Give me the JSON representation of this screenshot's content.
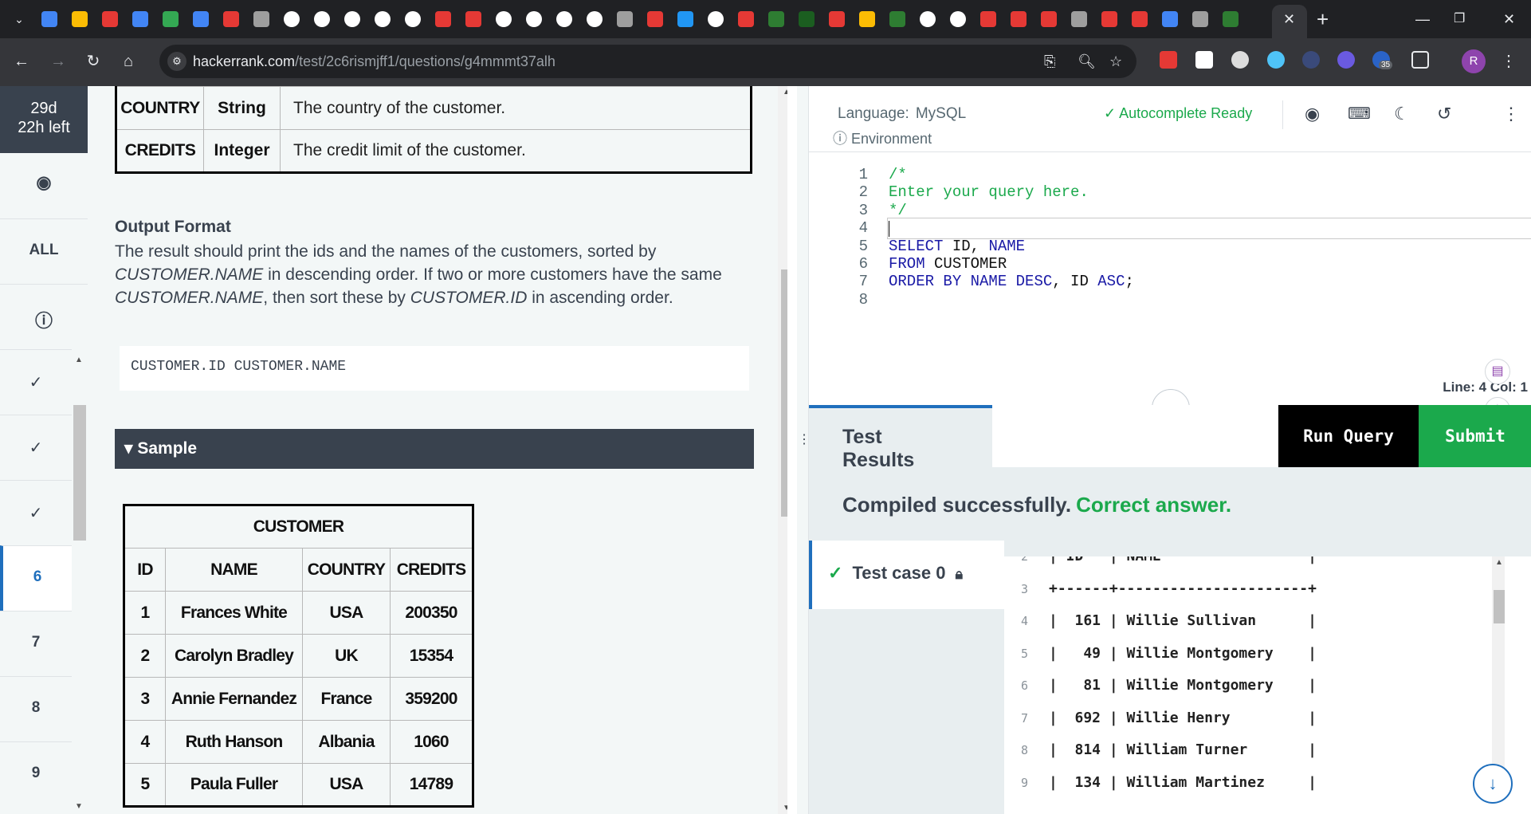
{
  "browser": {
    "url_domain": "hackerrank.com",
    "url_path": "/test/2c6rismjff1/questions/g4mmmt37alh",
    "ext_badge": "35",
    "profile_initial": "R",
    "tab_close": "✕",
    "new_tab": "+"
  },
  "rail": {
    "timer": "29d 22h left",
    "items": [
      {
        "label": "✓"
      },
      {
        "label": "✓"
      },
      {
        "label": "✓"
      },
      {
        "label": "6"
      },
      {
        "label": "7"
      },
      {
        "label": "8"
      },
      {
        "label": "9"
      }
    ],
    "all_label": "ALL"
  },
  "problem": {
    "schema_rows": [
      {
        "field": "COUNTRY",
        "type": "String",
        "desc": "The country of the customer."
      },
      {
        "field": "CREDITS",
        "type": "Integer",
        "desc": "The credit limit of the customer."
      }
    ],
    "output_heading": "Output Format",
    "output_text_1": "The result should print the ids and the names of the customers, sorted by ",
    "output_em_1": "CUSTOMER.NAME",
    "output_text_2": " in descending order. If two or more customers have the same ",
    "output_em_2": "CUSTOMER.NAME",
    "output_text_3": ", then sort these by ",
    "output_em_3": "CUSTOMER.ID",
    "output_text_4": " in ascending order.",
    "format_code": "CUSTOMER.ID CUSTOMER.NAME",
    "sample_label": "▾ Sample",
    "sample_table": {
      "caption": "CUSTOMER",
      "headers": [
        "ID",
        "NAME",
        "COUNTRY",
        "CREDITS"
      ],
      "rows": [
        [
          "1",
          "Frances White",
          "USA",
          "200350"
        ],
        [
          "2",
          "Carolyn Bradley",
          "UK",
          "15354"
        ],
        [
          "3",
          "Annie Fernandez",
          "France",
          "359200"
        ],
        [
          "4",
          "Ruth Hanson",
          "Albania",
          "1060"
        ],
        [
          "5",
          "Paula Fuller",
          "USA",
          "14789"
        ]
      ]
    }
  },
  "editor": {
    "language_label": "Language:",
    "language": "MySQL",
    "environment": "Environment",
    "autocomplete": "Autocomplete Ready",
    "status": "Line: 4 Col: 1",
    "lines": [
      {
        "n": "1",
        "parts": [
          {
            "t": "/*",
            "c": "cm"
          }
        ]
      },
      {
        "n": "2",
        "parts": [
          {
            "t": "Enter your query here.",
            "c": "cm"
          }
        ]
      },
      {
        "n": "3",
        "parts": [
          {
            "t": "*/",
            "c": "cm"
          }
        ]
      },
      {
        "n": "4",
        "parts": []
      },
      {
        "n": "5",
        "parts": [
          {
            "t": "SELECT",
            "c": "kw"
          },
          {
            "t": " ID, ",
            "c": ""
          },
          {
            "t": "NAME",
            "c": "kw"
          }
        ]
      },
      {
        "n": "6",
        "parts": [
          {
            "t": "FROM",
            "c": "kw"
          },
          {
            "t": " CUSTOMER",
            "c": ""
          }
        ]
      },
      {
        "n": "7",
        "parts": [
          {
            "t": "ORDER BY",
            "c": "kw"
          },
          {
            "t": " ",
            "c": ""
          },
          {
            "t": "NAME",
            "c": "kw"
          },
          {
            "t": " ",
            "c": ""
          },
          {
            "t": "DESC",
            "c": "kw"
          },
          {
            "t": ", ID ",
            "c": ""
          },
          {
            "t": "ASC",
            "c": "kw"
          },
          {
            "t": ";",
            "c": ""
          }
        ]
      },
      {
        "n": "8",
        "parts": []
      }
    ]
  },
  "results": {
    "tab_label": "Test Results",
    "run_label": "Run Query",
    "submit_label": "Submit",
    "compiled": "Compiled successfully.",
    "correct": "Correct answer.",
    "testcase_label": "Test case 0",
    "output_lines": [
      {
        "n": "2",
        "t": "| ID   | NAME                 |"
      },
      {
        "n": "3",
        "t": "+------+----------------------+"
      },
      {
        "n": "4",
        "t": "|  161 | Willie Sullivan      |"
      },
      {
        "n": "5",
        "t": "|   49 | Willie Montgomery    |"
      },
      {
        "n": "6",
        "t": "|   81 | Willie Montgomery    |"
      },
      {
        "n": "7",
        "t": "|  692 | Willie Henry         |"
      },
      {
        "n": "8",
        "t": "|  814 | William Turner       |"
      },
      {
        "n": "9",
        "t": "|  134 | William Martinez     |"
      }
    ]
  },
  "colors": {
    "green": "#1ba94c",
    "blue": "#1f6fbd",
    "dark": "#39424e"
  }
}
